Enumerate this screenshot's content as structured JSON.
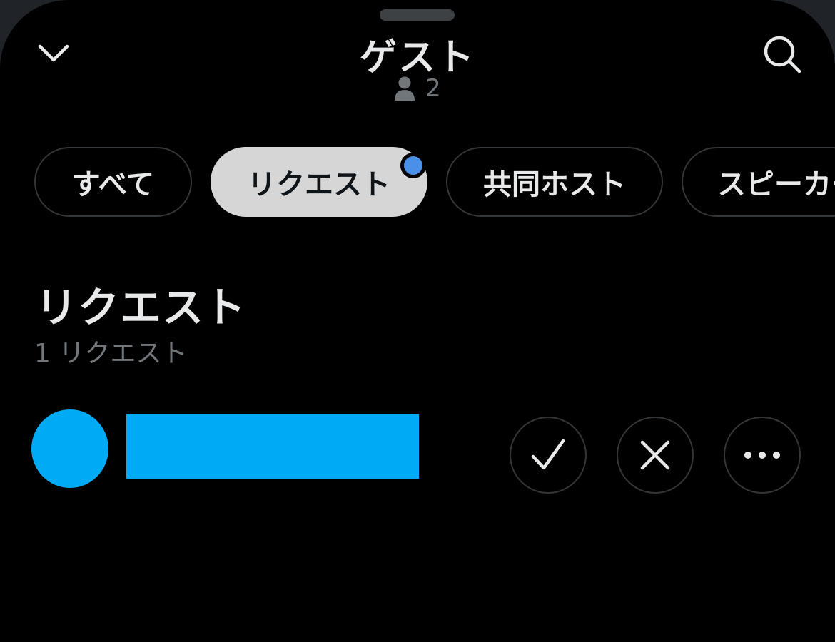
{
  "header": {
    "title": "ゲスト",
    "participant_count": "2",
    "icons": {
      "collapse": "chevron-down-icon",
      "search": "search-icon",
      "participants": "person-icon"
    }
  },
  "tabs": [
    {
      "label": "すべて",
      "selected": false
    },
    {
      "label": "リクエスト",
      "selected": true,
      "has_notification": true
    },
    {
      "label": "共同ホスト",
      "selected": false
    },
    {
      "label": "スピーカー",
      "selected": false
    }
  ],
  "section": {
    "title": "リクエスト",
    "subtitle": "1 リクエスト"
  },
  "requests": [
    {
      "actions": {
        "approve_icon": "check-icon",
        "deny_icon": "close-icon",
        "more_icon": "more-icon"
      }
    }
  ],
  "colors": {
    "background": "#000000",
    "text_primary": "#e7e9ea",
    "text_secondary": "#71767b",
    "selected_tab": "#d6d6d6",
    "notification_dot": "#4a90e8",
    "avatar_redaction": "#00aaf5"
  }
}
